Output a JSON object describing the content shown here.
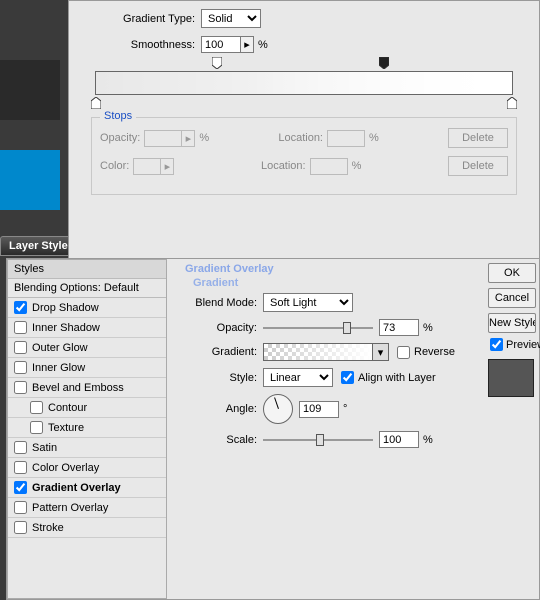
{
  "gradient_editor": {
    "gradient_type_label": "Gradient Type:",
    "gradient_type_value": "Solid",
    "smoothness_label": "Smoothness:",
    "smoothness_value": "100",
    "percent_sign": "%",
    "stops": {
      "legend": "Stops",
      "opacity_label": "Opacity:",
      "color_label": "Color:",
      "location_label": "Location:",
      "delete_label": "Delete"
    }
  },
  "tab": {
    "label": "Layer Style"
  },
  "layer_style": {
    "sidebar": {
      "header": "Styles",
      "subheader": "Blending Options: Default",
      "items": [
        {
          "label": "Drop Shadow",
          "checked": true,
          "sub": false
        },
        {
          "label": "Inner Shadow",
          "checked": false,
          "sub": false
        },
        {
          "label": "Outer Glow",
          "checked": false,
          "sub": false
        },
        {
          "label": "Inner Glow",
          "checked": false,
          "sub": false
        },
        {
          "label": "Bevel and Emboss",
          "checked": false,
          "sub": false
        },
        {
          "label": "Contour",
          "checked": false,
          "sub": true
        },
        {
          "label": "Texture",
          "checked": false,
          "sub": true
        },
        {
          "label": "Satin",
          "checked": false,
          "sub": false
        },
        {
          "label": "Color Overlay",
          "checked": false,
          "sub": false
        },
        {
          "label": "Gradient Overlay",
          "checked": true,
          "sub": false,
          "selected": true
        },
        {
          "label": "Pattern Overlay",
          "checked": false,
          "sub": false
        },
        {
          "label": "Stroke",
          "checked": false,
          "sub": false
        }
      ]
    },
    "main": {
      "title": "Gradient Overlay",
      "sub": "Gradient",
      "blend_mode_label": "Blend Mode:",
      "blend_mode_value": "Soft Light",
      "opacity_label": "Opacity:",
      "opacity_value": "73",
      "gradient_label": "Gradient:",
      "reverse_label": "Reverse",
      "style_label": "Style:",
      "style_value": "Linear",
      "align_label": "Align with Layer",
      "angle_label": "Angle:",
      "angle_value": "109",
      "degree_sign": "°",
      "scale_label": "Scale:",
      "scale_value": "100",
      "percent_sign": "%"
    },
    "right": {
      "ok": "OK",
      "cancel": "Cancel",
      "new_style": "New Style...",
      "preview": "Preview"
    }
  }
}
